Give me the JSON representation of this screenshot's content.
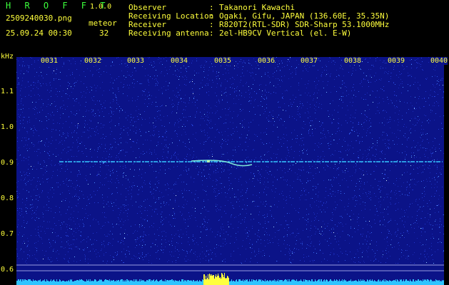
{
  "header": {
    "brand": "H R O F F T",
    "version": "1.0.0",
    "filename": "2509240030.png",
    "datetime": "25.09.24 00:30",
    "meteor_label": "meteor",
    "meteor_count": "32",
    "colon": ":",
    "info": [
      {
        "label": "Observer",
        "value": "Takanori Kawachi"
      },
      {
        "label": "Receiving Location",
        "value": "Ogaki, Gifu, JAPAN (136.60E, 35.35N)"
      },
      {
        "label": "Receiver",
        "value": "R820T2(RTL-SDR) SDR-Sharp 53.1000MHz"
      },
      {
        "label": "Receiving antenna",
        "value": "2el-HB9CV Vertical (el. E-W)"
      }
    ]
  },
  "chart_data": {
    "type": "heatmap",
    "y_unit": "kHz",
    "y_ticks": [
      "1.1",
      "1.0",
      "0.9",
      "0.8",
      "0.7",
      "0.6"
    ],
    "x_ticks": [
      "0031",
      "0032",
      "0033",
      "0034",
      "0035",
      "0036",
      "0037",
      "0038",
      "0039",
      "0040"
    ],
    "ylim": [
      0.58,
      1.19
    ],
    "signal_freq": 0.906,
    "background_color": "#0b1388",
    "signal_color": "#35c8ff",
    "baseline_color": "#2ec4ff",
    "burst_color": "#ffff3c"
  }
}
